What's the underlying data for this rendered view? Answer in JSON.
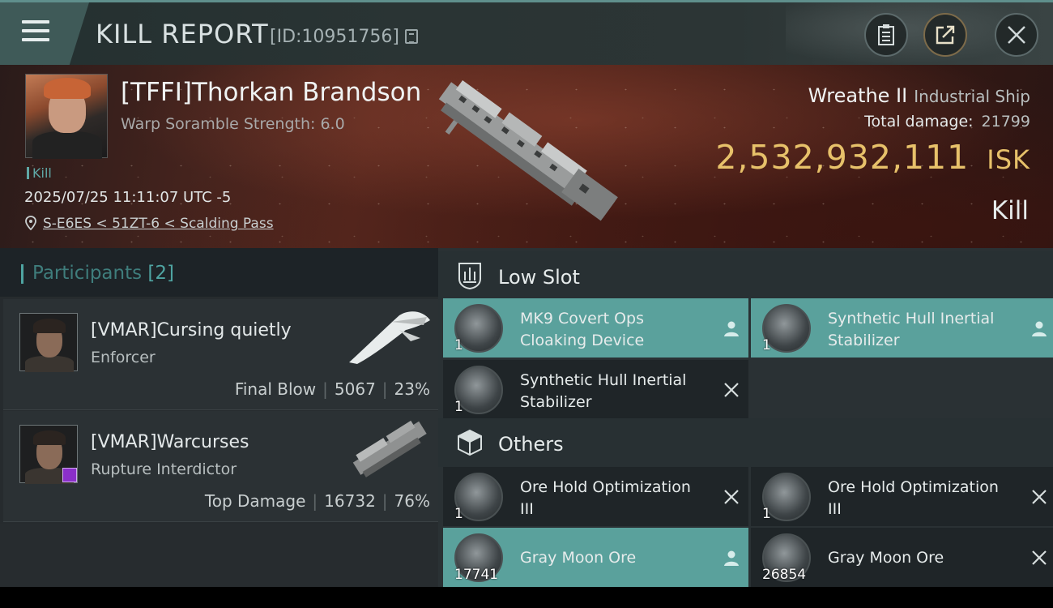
{
  "header": {
    "title": "KILL REPORT",
    "report_id": "[ID:10951756]"
  },
  "victim": {
    "name": "[TFFI]Thorkan Brandson",
    "scramble": "Warp Soramble Strength: 6.0",
    "tag": "Kill",
    "datetime": "2025/07/25 11:11:07 UTC -5",
    "location": "S-E6ES < 51ZT-6 < Scalding Pass",
    "ship_name": "Wreathe II",
    "ship_class": "Industrial Ship",
    "total_damage_label": "Total damage:",
    "total_damage": "21799",
    "isk_value": "2,532,932,111",
    "isk_unit": "ISK",
    "result": "Kill"
  },
  "participants": {
    "label": "Participants",
    "count": "[2]",
    "rows": [
      {
        "name": "[VMAR]Cursing quietly",
        "ship": "Enforcer",
        "role": "Final Blow",
        "damage": "5067",
        "percent": "23%"
      },
      {
        "name": "[VMAR]Warcurses",
        "ship": "Rupture Interdictor",
        "role": "Top Damage",
        "damage": "16732",
        "percent": "76%"
      }
    ]
  },
  "modules": {
    "low_slot_label": "Low Slot",
    "others_label": "Others",
    "items": [
      {
        "name": "MK9 Covert Ops Cloaking Device",
        "qty": "1",
        "state": "dropped"
      },
      {
        "name": "Synthetic Hull Inertial Stabilizer",
        "qty": "1",
        "state": "dropped"
      },
      {
        "name": "Synthetic Hull Inertial Stabilizer",
        "qty": "1",
        "state": "destroyed"
      },
      {
        "name": "Ore Hold Optimization III",
        "qty": "1",
        "state": "destroyed"
      },
      {
        "name": "Ore Hold Optimization III",
        "qty": "1",
        "state": "destroyed"
      },
      {
        "name": "Gray Moon Ore",
        "qty": "17741",
        "state": "dropped"
      },
      {
        "name": "Gray Moon Ore",
        "qty": "26854",
        "state": "destroyed"
      }
    ]
  },
  "colors": {
    "accent": "#5aa19c",
    "isk": "#e7c16a",
    "dropped_bg": "#5aa19c",
    "destroyed_bg": "#1f2528"
  },
  "icons": {
    "menu": "menu-icon",
    "copy": "copy-icon",
    "clipboard": "clipboard-icon",
    "share": "share-icon",
    "close": "close-icon",
    "location": "location-pin-icon",
    "low_slot": "low-slot-icon",
    "others": "cube-icon",
    "dropped": "person-icon",
    "destroyed": "x-icon"
  }
}
